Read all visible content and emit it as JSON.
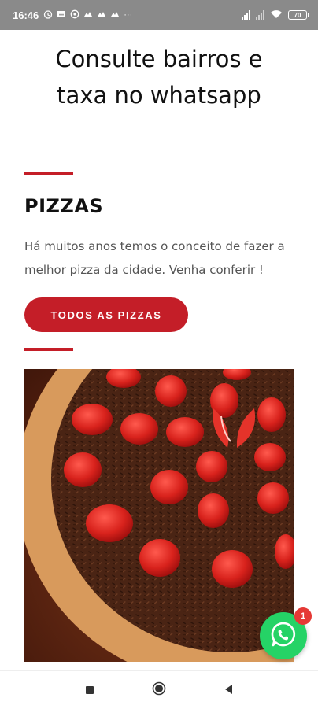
{
  "status_bar": {
    "time": "16:46",
    "notification_icons": [
      "alarm-icon",
      "mail-icon",
      "whatsapp-icon",
      "app-icon",
      "app-icon",
      "app-icon",
      "more-icon"
    ],
    "more": "···",
    "battery": "70"
  },
  "headline": {
    "line1": "Consulte bairros e",
    "line2": "taxa no whatsapp"
  },
  "section": {
    "title": "PIZZAS",
    "description": "Há muitos anos temos o conceito de fazer a melhor pizza da cidade. Venha conferir !",
    "button_label": "TODOS AS PIZZAS"
  },
  "image": {
    "subject": "chocolate-strawberry-pizza"
  },
  "whatsapp_fab": {
    "badge_count": "1",
    "icon": "whatsapp-icon"
  },
  "nav": {
    "icons": [
      "recent-apps-icon",
      "home-icon",
      "back-icon"
    ]
  },
  "colors": {
    "accent": "#c41e28",
    "whatsapp": "#25d366",
    "status_bar": "#8a8a8a"
  }
}
